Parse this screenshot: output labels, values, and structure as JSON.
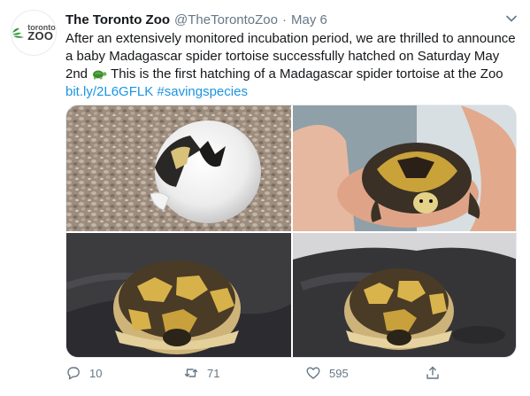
{
  "tweet": {
    "display_name": "The Toronto Zoo",
    "handle": "@TheTorontoZoo",
    "separator": "·",
    "date": "May 6",
    "text_before_emoji": "After an extensively monitored incubation period, we are thrilled to announce a baby Madagascar spider tortoise successfully hatched on Saturday May 2nd ",
    "emoji": "turtle",
    "text_after_emoji": " This is the first hatching of a Madagascar spider tortoise at the Zoo ",
    "link": "bit.ly/2L6GFLK",
    "hashtag": "#savingspecies"
  },
  "avatar": {
    "logo_small": "toronto",
    "logo_big": "ZOO",
    "brand_color": "#2e8b3a"
  },
  "media": [
    {
      "subject": "tortoise hatching from egg"
    },
    {
      "subject": "baby tortoise held in hand"
    },
    {
      "subject": "baby tortoise on dark fabric"
    },
    {
      "subject": "baby tortoise on dark fabric close-up"
    }
  ],
  "actions": {
    "reply_count": "10",
    "retweet_count": "71",
    "like_count": "595",
    "icons": [
      "reply-icon",
      "retweet-icon",
      "like-icon",
      "share-icon"
    ]
  },
  "colors": {
    "link": "#1b95e0",
    "text": "#14171a",
    "meta": "#657786"
  }
}
